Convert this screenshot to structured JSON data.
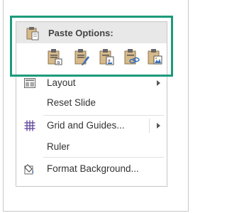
{
  "paste_options": {
    "title": "Paste Options:",
    "options": [
      {
        "icon": "paste-use-destination-theme-icon"
      },
      {
        "icon": "paste-keep-source-formatting-icon"
      },
      {
        "icon": "paste-embed-icon"
      },
      {
        "icon": "paste-link-icon"
      },
      {
        "icon": "paste-picture-icon"
      }
    ]
  },
  "menu": {
    "items": [
      {
        "label": "Layout",
        "icon": "layout-icon",
        "has_submenu": true
      },
      {
        "label": "Reset Slide",
        "icon": "",
        "has_submenu": false
      },
      {
        "label": "Grid and Guides...",
        "icon": "grid-icon",
        "has_submenu": true
      },
      {
        "label": "Ruler",
        "icon": "",
        "has_submenu": false
      },
      {
        "label": "Format Background...",
        "icon": "format-background-icon",
        "has_submenu": false
      }
    ]
  },
  "colors": {
    "highlight_border": "#1c9a7b",
    "header_background": "#e8e8e8",
    "clipboard_tan": "#d7b98a",
    "accent_blue": "#3a6fb8",
    "grid_purple": "#6a4fa0"
  }
}
